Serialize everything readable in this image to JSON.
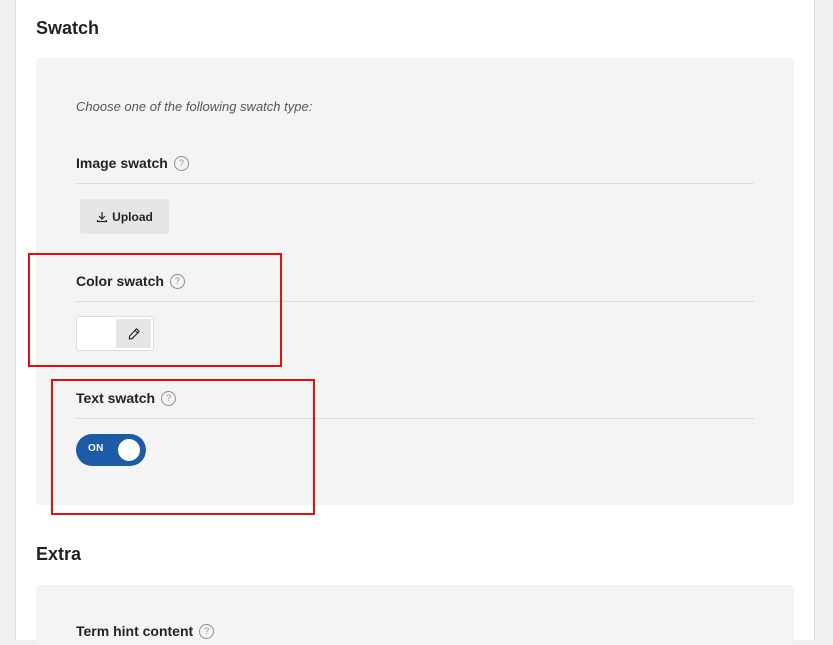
{
  "sections": {
    "swatch": {
      "title": "Swatch",
      "intro": "Choose one of the following swatch type:",
      "image_swatch": {
        "label": "Image swatch",
        "upload_label": "Upload"
      },
      "color_swatch": {
        "label": "Color swatch",
        "value": "#ffffff"
      },
      "text_swatch": {
        "label": "Text swatch",
        "toggle_label": "ON",
        "toggle_state": "on"
      }
    },
    "extra": {
      "title": "Extra",
      "term_hint": {
        "label": "Term hint content"
      }
    }
  },
  "icons": {
    "help": "?",
    "upload": "download-arrow-icon",
    "eyedropper": "eyedropper-icon"
  },
  "colors": {
    "toggle_on": "#1d5aa8",
    "highlight": "#e01010",
    "panel_bg": "#f4f4f4"
  }
}
